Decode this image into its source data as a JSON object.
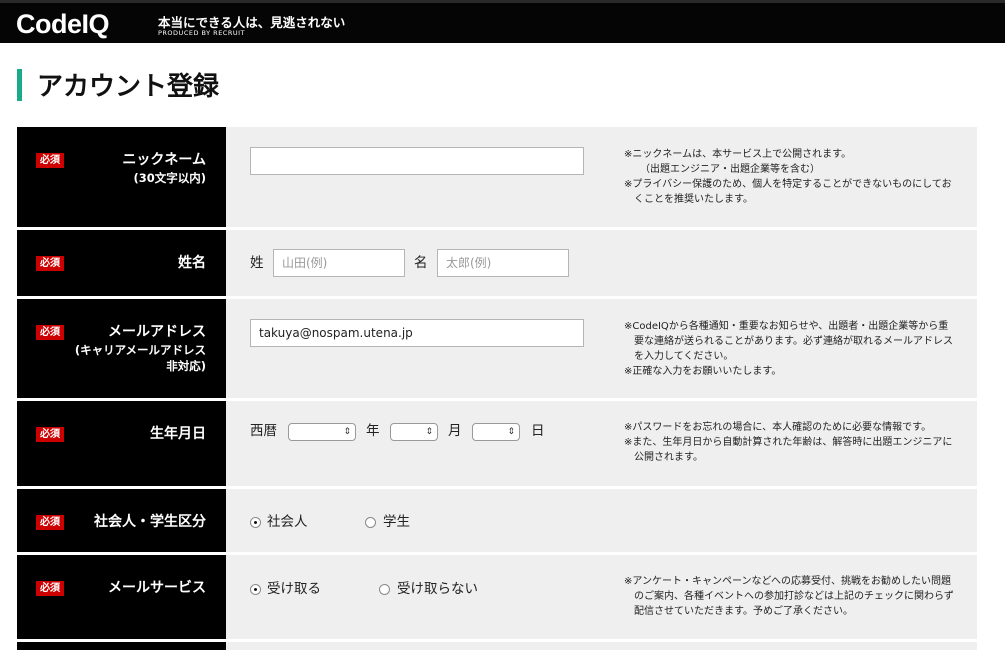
{
  "header": {
    "logo": "CodeIQ",
    "tagline": "本当にできる人は、見逃されない",
    "produced_by": "PRODUCED BY RECRUIT"
  },
  "page": {
    "title": "アカウント登録"
  },
  "required_badge": "必須",
  "rows": {
    "nickname": {
      "label": "ニックネーム",
      "sub": "(30文字以内)",
      "value": "",
      "notes": [
        "※ニックネームは、本サービス上で公開されます。",
        "（出題エンジニア・出題企業等を含む）",
        "※プライバシー保護のため、個人を特定することができないものにしてお",
        "くことを推奨いたします。"
      ]
    },
    "name": {
      "label": "姓名",
      "sei_label": "姓",
      "sei_placeholder": "山田(例)",
      "mei_label": "名",
      "mei_placeholder": "太郎(例)"
    },
    "email": {
      "label": "メールアドレス",
      "sub1": "(キャリアメールアドレス",
      "sub2": "非対応)",
      "value": "takuya@nospam.utena.jp",
      "notes": [
        "※CodeIQから各種通知・重要なお知らせや、出題者・出題企業等から重",
        "要な連絡が送られることがあります。必ず連絡が取れるメールアドレス",
        "を入力してください。",
        "※正確な入力をお願いいたします。"
      ]
    },
    "birthday": {
      "label": "生年月日",
      "era_label": "西暦",
      "year_label": "年",
      "month_label": "月",
      "day_label": "日",
      "notes": [
        "※パスワードをお忘れの場合に、本人確認のために必要な情報です。",
        "※また、生年月日から自動計算された年齢は、解答時に出題エンジニアに",
        "公開されます。"
      ]
    },
    "status": {
      "label": "社会人・学生区分",
      "option1": "社会人",
      "option2": "学生",
      "selected": "社会人"
    },
    "mail_service": {
      "label": "メールサービス",
      "option1": "受け取る",
      "option2": "受け取らない",
      "selected": "受け取る",
      "notes": [
        "※アンケート・キャンペーンなどへの応募受付、挑戦をお勧めしたい問題",
        "のご案内、各種イベントへの参加打診などは上記のチェックに関わらず",
        "配信させていただきます。予めご了承ください。"
      ]
    }
  },
  "colors": {
    "accent": "#1aab8a",
    "required": "#cc0000",
    "header_bg": "#050505",
    "row_bg": "#efefef"
  }
}
